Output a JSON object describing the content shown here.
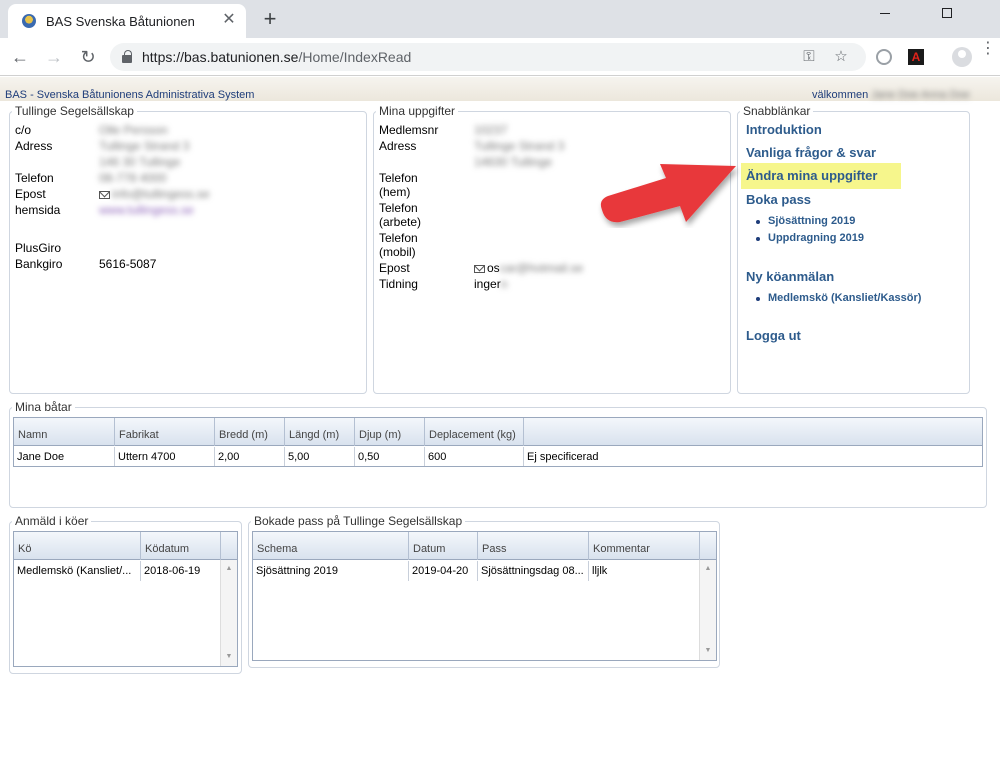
{
  "browser": {
    "tab_title": "BAS Svenska Båtunionen",
    "tab_close": "✕",
    "new_tab": "+",
    "url_host": "https://bas.batunionen.se",
    "url_path": "/Home/IndexRead",
    "back": "←",
    "forward": "→",
    "reload": "↻",
    "key_glyph": "⚿",
    "star_glyph": "☆",
    "menu_glyph": "⋮"
  },
  "header": {
    "site_title": "BAS - Svenska Båtunionens Administrativa System",
    "welcome_text": "välkommen",
    "welcome_user": "Jane Doe Anna Doe"
  },
  "club": {
    "legend": "Tullinge Segelsällskap",
    "labels": {
      "co": "c/o",
      "address": "Adress",
      "phone": "Telefon",
      "email": "Epost",
      "homepage": "hemsida",
      "plusgiro": "PlusGiro",
      "bankgiro": "Bankgiro"
    },
    "values": {
      "co": "Olle Persson",
      "address_1": "Tullinge Strand 3",
      "address_2": "146 30 Tullinge",
      "phone": "08-778 4000",
      "email": "info@tullingess.se",
      "homepage": "www.tullingess.se",
      "bankgiro": "5616-5087"
    }
  },
  "member": {
    "legend": "Mina uppgifter",
    "labels": {
      "number": "Medlemsnr",
      "address": "Adress",
      "phone_home_1": "Telefon",
      "phone_home_2": "(hem)",
      "phone_work_1": "Telefon",
      "phone_work_2": "(arbete)",
      "phone_mobile_1": "Telefon",
      "phone_mobile_2": "(mobil)",
      "email": "Epost",
      "magazine": "Tidning"
    },
    "values": {
      "number": "10237",
      "address_1": "Tullinge Strand 3",
      "address_2": "14630 Tullinge",
      "email_prefix": "os",
      "email_rest": "car@hotmail.se",
      "magazine_prefix": "inger",
      "magazine_rest": "n"
    }
  },
  "quicklinks": {
    "legend": "Snabblänkar",
    "intro": "Introduktion",
    "faq": "Vanliga frågor & svar",
    "edit_profile": "Ändra mina uppgifter",
    "book_shift": "Boka pass",
    "book_items": [
      "Sjösättning 2019",
      "Uppdragning 2019"
    ],
    "new_queue": "Ny köanmälan",
    "queue_items": [
      "Medlemskö (Kansliet/Kassör)"
    ],
    "logout": "Logga ut"
  },
  "boats": {
    "legend": "Mina båtar",
    "columns": [
      "Namn",
      "Fabrikat",
      "Bredd (m)",
      "Längd (m)",
      "Djup (m)",
      "Deplacement (kg)",
      ""
    ],
    "rows": [
      [
        "Jane Doe",
        "Uttern 4700",
        "2,00",
        "5,00",
        "0,50",
        "600",
        "Ej specificerad"
      ]
    ]
  },
  "queues": {
    "legend": "Anmäld i köer",
    "columns": [
      "Kö",
      "Ködatum"
    ],
    "rows": [
      [
        "Medlemskö (Kansliet/...",
        "2018-06-19"
      ]
    ]
  },
  "booked": {
    "legend": "Bokade pass på Tullinge Segelsällskap",
    "columns": [
      "Schema",
      "Datum",
      "Pass",
      "Kommentar"
    ],
    "rows": [
      [
        "Sjösättning 2019",
        "2019-04-20",
        "Sjösättningsdag 08...",
        "lljlk"
      ]
    ]
  },
  "colors": {
    "link": "#2d5b8c",
    "highlight": "#f6f68c",
    "arrow": "#e8393b"
  }
}
